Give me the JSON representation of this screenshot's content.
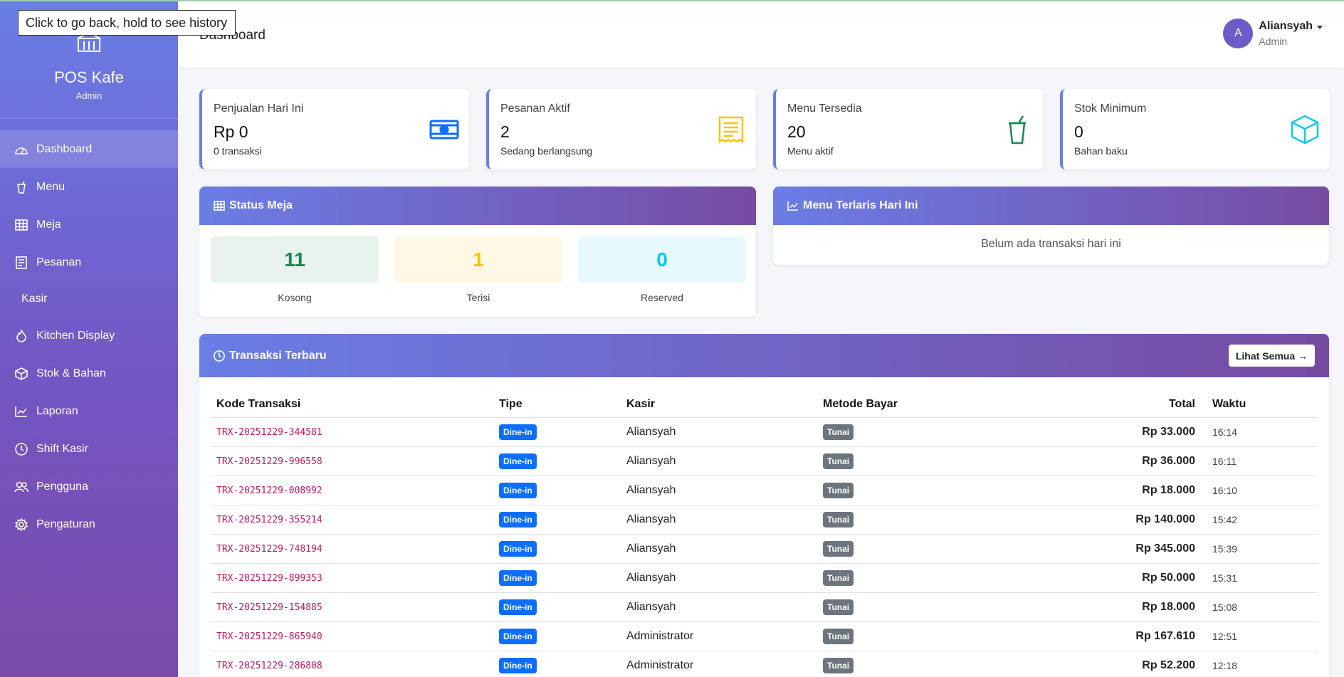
{
  "browser": {
    "back_tooltip": "Click to go back, hold to see history"
  },
  "sidebar": {
    "brand_title": "POS Kafe",
    "brand_sub": "Admin",
    "items": [
      {
        "label": "Dashboard",
        "icon": "dashboard-icon"
      },
      {
        "label": "Menu",
        "icon": "cup-icon"
      },
      {
        "label": "Meja",
        "icon": "table-icon"
      },
      {
        "label": "Pesanan",
        "icon": "receipt-icon"
      },
      {
        "label": "Kasir",
        "icon": ""
      },
      {
        "label": "Kitchen Display",
        "icon": "fire-icon"
      },
      {
        "label": "Stok & Bahan",
        "icon": "box-icon"
      },
      {
        "label": "Laporan",
        "icon": "chart-icon"
      },
      {
        "label": "Shift Kasir",
        "icon": "clock-icon"
      },
      {
        "label": "Pengguna",
        "icon": "users-icon"
      },
      {
        "label": "Pengaturan",
        "icon": "gear-icon"
      }
    ]
  },
  "header": {
    "title": "Dashboard",
    "user_initial": "A",
    "user_name": "Aliansyah",
    "user_role": "Admin"
  },
  "stats": [
    {
      "label": "Penjualan Hari Ini",
      "value": "Rp 0",
      "sub": "0 transaksi",
      "icon": "cash-icon",
      "color": "#0d6efd"
    },
    {
      "label": "Pesanan Aktif",
      "value": "2",
      "sub": "Sedang berlangsung",
      "icon": "receipt-icon",
      "color": "#ffc107"
    },
    {
      "label": "Menu Tersedia",
      "value": "20",
      "sub": "Menu aktif",
      "icon": "cup-icon",
      "color": "#198754"
    },
    {
      "label": "Stok Minimum",
      "value": "0",
      "sub": "Bahan baku",
      "icon": "box-icon",
      "color": "#0dcaf0"
    }
  ],
  "status_meja": {
    "title": "Status Meja",
    "tiles": [
      {
        "value": "11",
        "label": "Kosong",
        "color": "#198754",
        "bg": "#e8f3ee"
      },
      {
        "value": "1",
        "label": "Terisi",
        "color": "#ffc107",
        "bg": "#fff8e5"
      },
      {
        "value": "0",
        "label": "Reserved",
        "color": "#0dcaf0",
        "bg": "#e7f9fc"
      }
    ]
  },
  "terlaris": {
    "title": "Menu Terlaris Hari Ini",
    "empty": "Belum ada transaksi hari ini"
  },
  "transaksi": {
    "title": "Transaksi Terbaru",
    "button": "Lihat Semua →",
    "columns": [
      "Kode Transaksi",
      "Tipe",
      "Kasir",
      "Metode Bayar",
      "Total",
      "Waktu"
    ],
    "rows": [
      {
        "kode": "TRX-20251229-344581",
        "tipe": "Dine-in",
        "kasir": "Aliansyah",
        "metode": "Tunai",
        "total": "Rp 33.000",
        "waktu": "16:14"
      },
      {
        "kode": "TRX-20251229-996558",
        "tipe": "Dine-in",
        "kasir": "Aliansyah",
        "metode": "Tunai",
        "total": "Rp 36.000",
        "waktu": "16:11"
      },
      {
        "kode": "TRX-20251229-008992",
        "tipe": "Dine-in",
        "kasir": "Aliansyah",
        "metode": "Tunai",
        "total": "Rp 18.000",
        "waktu": "16:10"
      },
      {
        "kode": "TRX-20251229-355214",
        "tipe": "Dine-in",
        "kasir": "Aliansyah",
        "metode": "Tunai",
        "total": "Rp 140.000",
        "waktu": "15:42"
      },
      {
        "kode": "TRX-20251229-748194",
        "tipe": "Dine-in",
        "kasir": "Aliansyah",
        "metode": "Tunai",
        "total": "Rp 345.000",
        "waktu": "15:39"
      },
      {
        "kode": "TRX-20251229-899353",
        "tipe": "Dine-in",
        "kasir": "Aliansyah",
        "metode": "Tunai",
        "total": "Rp 50.000",
        "waktu": "15:31"
      },
      {
        "kode": "TRX-20251229-154885",
        "tipe": "Dine-in",
        "kasir": "Aliansyah",
        "metode": "Tunai",
        "total": "Rp 18.000",
        "waktu": "15:08"
      },
      {
        "kode": "TRX-20251229-865940",
        "tipe": "Dine-in",
        "kasir": "Administrator",
        "metode": "Tunai",
        "total": "Rp 167.610",
        "waktu": "12:51"
      },
      {
        "kode": "TRX-20251229-286808",
        "tipe": "Dine-in",
        "kasir": "Administrator",
        "metode": "Tunai",
        "total": "Rp 52.200",
        "waktu": "12:18"
      }
    ]
  }
}
